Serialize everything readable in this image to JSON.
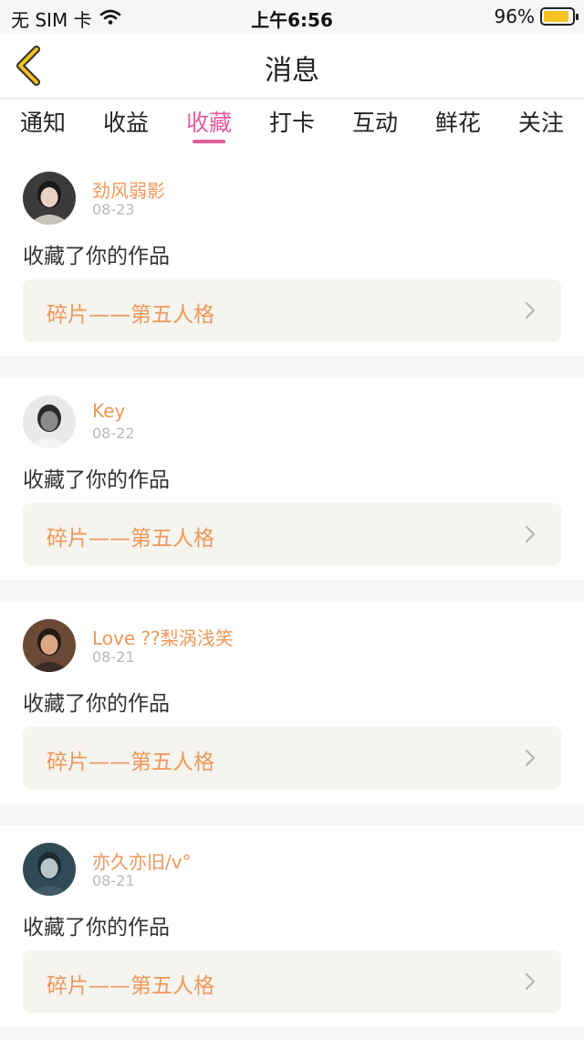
{
  "status_bar": {
    "carrier": "无 SIM 卡",
    "time": "上午6:56",
    "battery": "96%",
    "battery_level": 0.96
  },
  "nav": {
    "title": "消息"
  },
  "tabs": [
    {
      "label": "通知",
      "active": false
    },
    {
      "label": "收益",
      "active": false
    },
    {
      "label": "收藏",
      "active": true
    },
    {
      "label": "打卡",
      "active": false
    },
    {
      "label": "互动",
      "active": false
    },
    {
      "label": "鲜花",
      "active": false
    },
    {
      "label": "关注",
      "active": false
    }
  ],
  "colors": {
    "accent": "#e45c9b",
    "name": "#f0975a",
    "card_bg": "#f5f4ee"
  },
  "items": [
    {
      "user": "劲风弱影",
      "date": "08-23",
      "action": "收藏了你的作品",
      "work": "碎片——第五人格"
    },
    {
      "user": "Key",
      "date": "08-22",
      "action": "收藏了你的作品",
      "work": "碎片——第五人格"
    },
    {
      "user": "Love ??梨涡浅笑",
      "date": "08-21",
      "action": "收藏了你的作品",
      "work": "碎片——第五人格"
    },
    {
      "user": "亦久亦旧/v°",
      "date": "08-21",
      "action": "收藏了你的作品",
      "work": "碎片——第五人格"
    }
  ]
}
